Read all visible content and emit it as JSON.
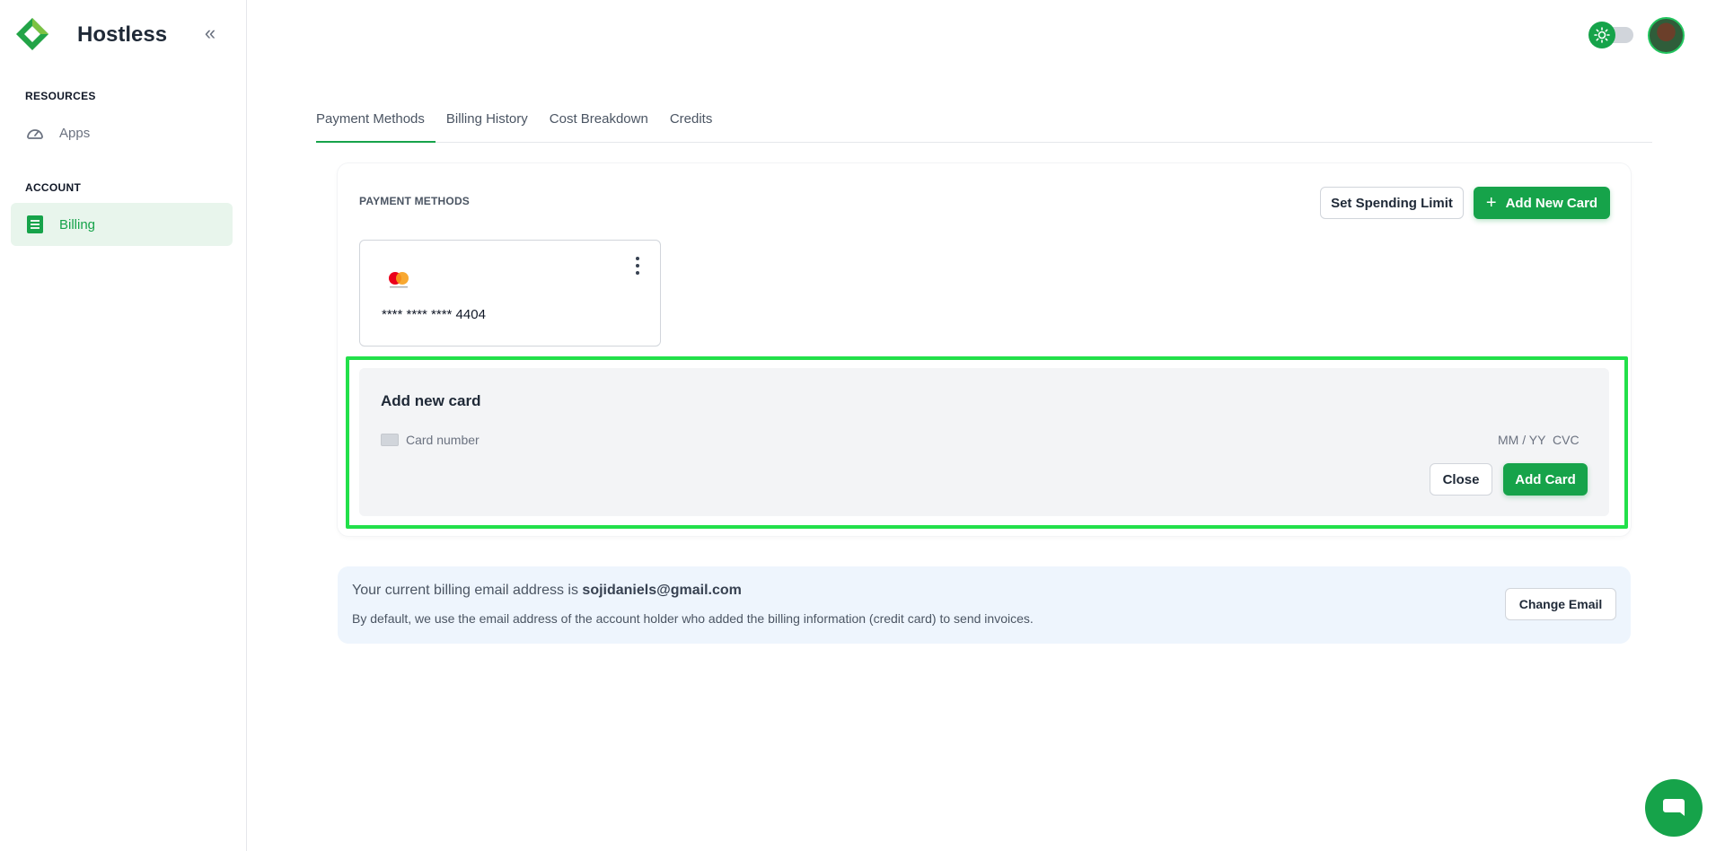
{
  "app": {
    "name": "Hostless"
  },
  "sidebar": {
    "sections": [
      {
        "title": "RESOURCES",
        "items": [
          {
            "label": "Apps",
            "icon": "gauge-icon",
            "active": false
          }
        ]
      },
      {
        "title": "ACCOUNT",
        "items": [
          {
            "label": "Billing",
            "icon": "billing-icon",
            "active": true
          }
        ]
      }
    ]
  },
  "tabs": [
    {
      "label": "Payment Methods",
      "active": true
    },
    {
      "label": "Billing History",
      "active": false
    },
    {
      "label": "Cost Breakdown",
      "active": false
    },
    {
      "label": "Credits",
      "active": false
    }
  ],
  "payment_methods": {
    "title": "PAYMENT METHODS",
    "set_limit_label": "Set Spending Limit",
    "add_new_card_label": "Add New Card",
    "cards": [
      {
        "brand": "mastercard",
        "number": "**** **** **** 4404"
      }
    ]
  },
  "add_card_form": {
    "title": "Add new card",
    "card_number_placeholder": "Card number",
    "expiry_placeholder": "MM / YY",
    "cvc_placeholder": "CVC",
    "close_label": "Close",
    "submit_label": "Add Card"
  },
  "billing_email": {
    "prefix": "Your current billing email address is ",
    "email": "sojidaniels@gmail.com",
    "note": "By default, we use the email address of the account holder who added the billing information (credit card) to send invoices.",
    "change_label": "Change Email"
  },
  "colors": {
    "accent": "#16a34a",
    "highlight": "#22e04a",
    "email_box_bg": "#eef5fd"
  }
}
